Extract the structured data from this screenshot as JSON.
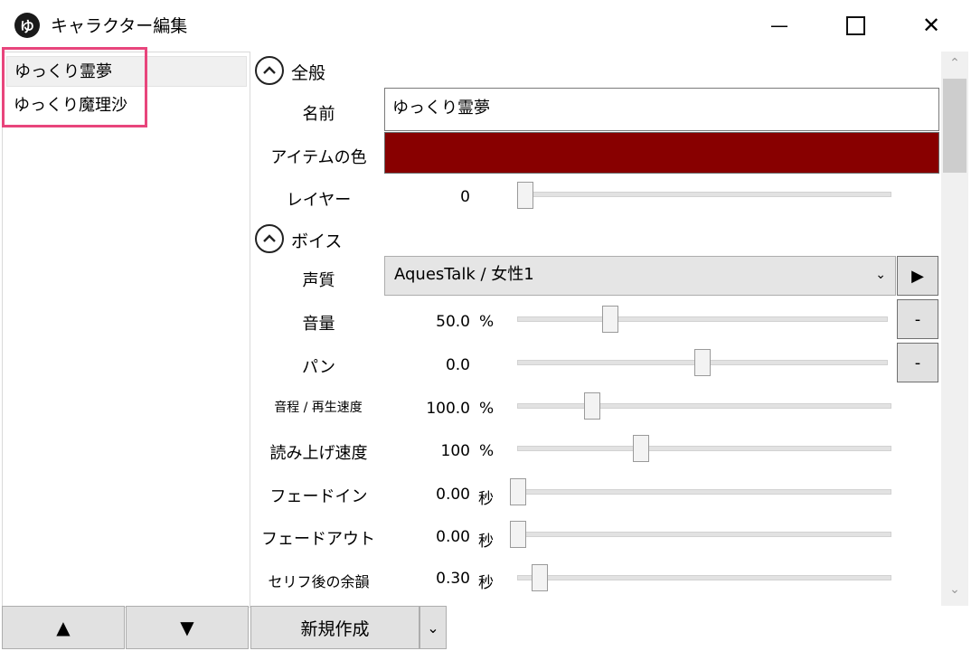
{
  "window": {
    "title": "キャラクター編集",
    "app_icon_glyph": "ゆ",
    "minimize_glyph": "—",
    "maximize_glyph": "☐",
    "close_glyph": "✕"
  },
  "characters": [
    {
      "name": "ゆっくり霊夢",
      "selected": true
    },
    {
      "name": "ゆっくり魔理沙",
      "selected": false
    }
  ],
  "bottom_buttons": {
    "up_glyph": "▲",
    "down_glyph": "▼",
    "new_label": "新規作成",
    "new_dropdown_glyph": "⌄"
  },
  "sections": {
    "general": {
      "label": "全般",
      "expanded": true
    },
    "voice": {
      "label": "ボイス",
      "expanded": true
    }
  },
  "general": {
    "name_label": "名前",
    "name_value": "ゆっくり霊夢",
    "item_color_label": "アイテムの色",
    "item_color": "#880000",
    "layer_label": "レイヤー",
    "layer_value": "0",
    "layer_fraction": 0.0
  },
  "voice": {
    "quality_label": "声質",
    "quality_value": "AquesTalk / 女性1",
    "combo_arrow": "⌄",
    "play_glyph": "▶",
    "volume_label": "音量",
    "volume_value": "50.0",
    "volume_unit": "%",
    "volume_fraction": 0.25,
    "volume_reset": "-",
    "pan_label": "パン",
    "pan_value": "0.0",
    "pan_fraction": 0.5,
    "pan_reset": "-",
    "pitch_label": "音程 / 再生速度",
    "pitch_value": "100.0",
    "pitch_unit": "%",
    "pitch_fraction": 0.2,
    "speed_label": "読み上げ速度",
    "speed_value": "100",
    "speed_unit": "%",
    "speed_fraction": 0.33,
    "fadein_label": "フェードイン",
    "fadein_value": "0.00",
    "fadein_unit": "秒",
    "fadein_fraction": 0.0,
    "fadeout_label": "フェードアウト",
    "fadeout_value": "0.00",
    "fadeout_unit": "秒",
    "fadeout_fraction": 0.0,
    "afterglow_label": "セリフ後の余韻",
    "afterglow_value": "0.30",
    "afterglow_unit": "秒",
    "afterglow_fraction": 0.06
  },
  "scrollbar": {
    "up_glyph": "⌃",
    "down_glyph": "⌄"
  },
  "colors": {
    "highlight": "#e8457c",
    "item_color": "#880000"
  }
}
